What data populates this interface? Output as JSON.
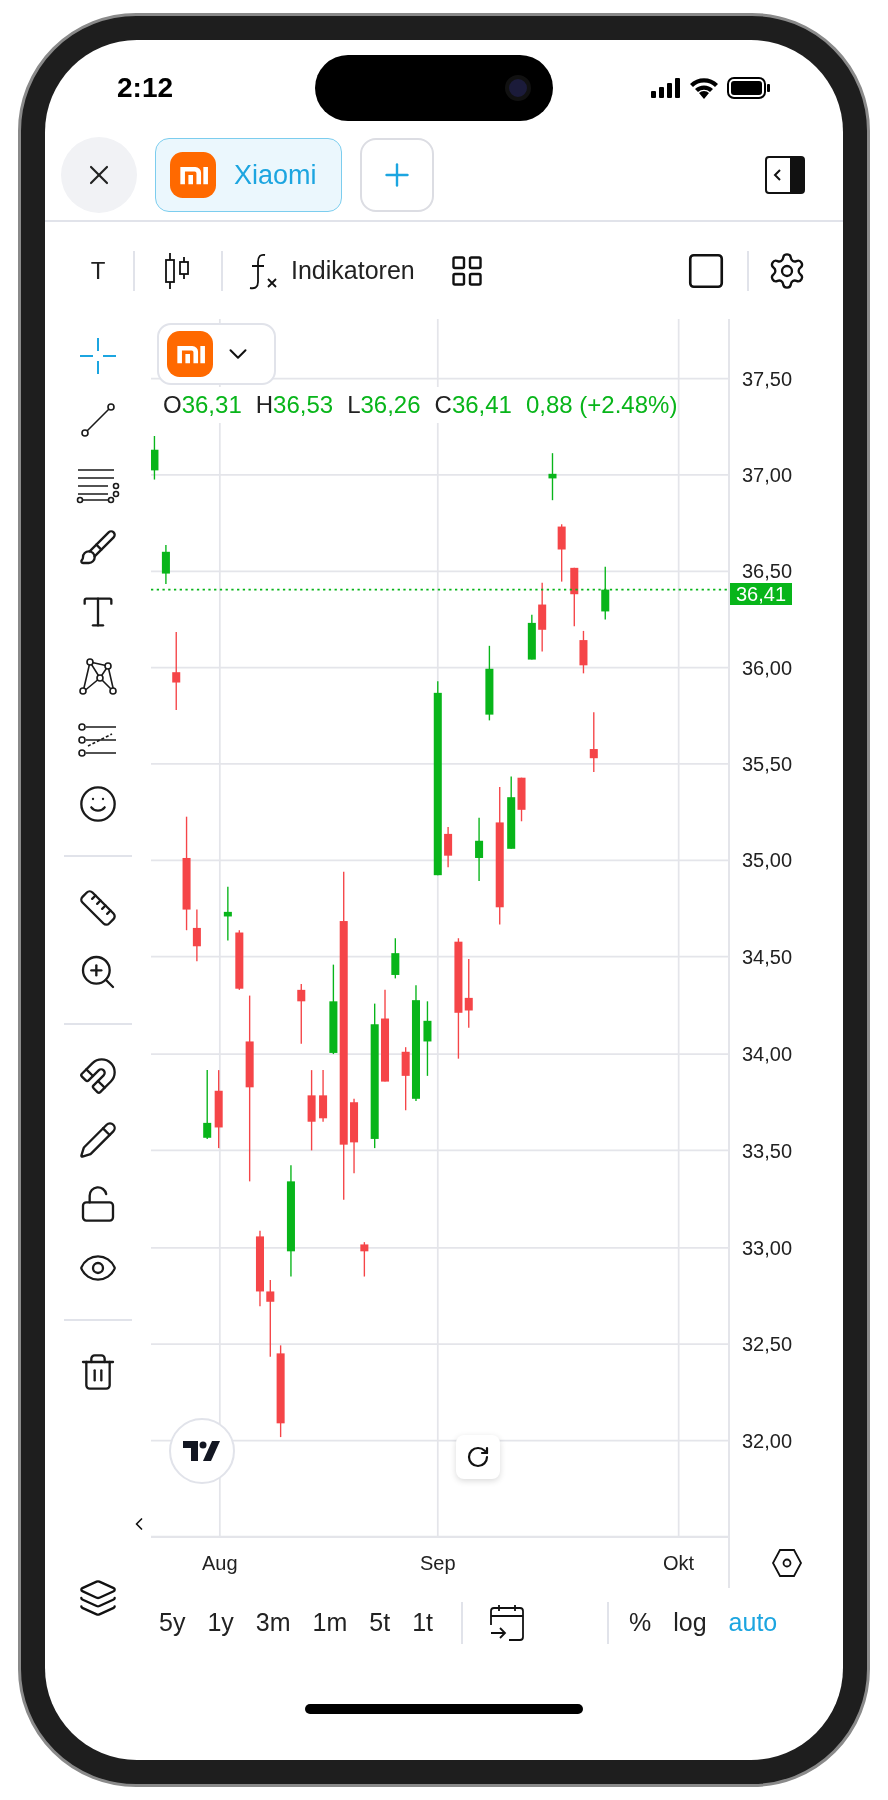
{
  "status_bar": {
    "time": "2:12"
  },
  "tabs": [
    {
      "label": "Xiaomi",
      "selected": true
    }
  ],
  "toolbar": {
    "interval": "T",
    "indicators_label": "Indikatoren"
  },
  "tool_groups": [
    [
      {
        "kind": "crosshair",
        "selected": true
      },
      {
        "kind": "trend-line",
        "selected": false
      },
      {
        "kind": "fib",
        "selected": false
      },
      {
        "kind": "brush",
        "selected": false
      },
      {
        "kind": "text",
        "selected": false
      },
      {
        "kind": "pattern",
        "selected": false
      },
      {
        "kind": "forecast",
        "selected": false
      },
      {
        "kind": "emoji",
        "selected": false
      }
    ],
    [
      {
        "kind": "ruler",
        "selected": false
      },
      {
        "kind": "zoom",
        "selected": false
      }
    ],
    [
      {
        "kind": "magnet",
        "selected": false
      },
      {
        "kind": "lock-drawings",
        "selected": false
      },
      {
        "kind": "lock",
        "selected": false
      },
      {
        "kind": "hide",
        "selected": false
      }
    ],
    [
      {
        "kind": "trash",
        "selected": false
      }
    ]
  ],
  "legend": [
    {
      "label": "O",
      "value": "36,31"
    },
    {
      "label": "H",
      "value": "36,53"
    },
    {
      "label": "L",
      "value": "36,26"
    },
    {
      "label": "C",
      "value": "36,41"
    },
    {
      "value": "0,88 (+2.48%)"
    }
  ],
  "price_axis": [
    "37,50",
    "37,00",
    "36,50",
    "36,00",
    "35,50",
    "35,00",
    "34,50",
    "34,00",
    "33,50",
    "33,00",
    "32,50",
    "32,00"
  ],
  "last_price": "36,41",
  "time_axis": [
    "Aug",
    "Sep",
    "Okt"
  ],
  "ranges": [
    "5y",
    "1y",
    "3m",
    "1m",
    "5t",
    "1t"
  ],
  "scale_options": [
    {
      "label": "%",
      "selected": false
    },
    {
      "label": "log",
      "selected": false
    },
    {
      "label": "auto",
      "selected": true
    }
  ]
}
